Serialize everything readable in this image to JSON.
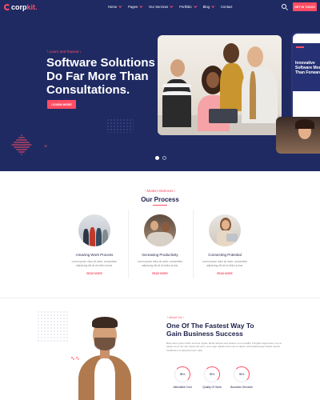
{
  "brand": {
    "logo_main": "corp",
    "logo_accent": "kit."
  },
  "nav": {
    "items": [
      {
        "label": "Home"
      },
      {
        "label": "Pages"
      },
      {
        "label": "Our Services"
      },
      {
        "label": "Portfolio"
      },
      {
        "label": "Blog"
      },
      {
        "label": "Contact"
      }
    ],
    "cta": "GET IN TOUCH"
  },
  "hero": {
    "eyebrow": "\\ Learn and Repeat \\",
    "title": "Software Solutions Do Far More Than Consultations.",
    "button": "LEARN MORE",
    "phone_text": "Innovative Software More Than Forward"
  },
  "process": {
    "eyebrow": "\\ Modern Business \\",
    "title": "Our Process",
    "steps": [
      {
        "title": "Amazing Work Process",
        "desc": "Lorem ipsum dolor sit amet, consectetur adipiscing elit sit do tellus luctus.",
        "link": "READ MORE"
      },
      {
        "title": "Increasing Productivity",
        "desc": "Lorem ipsum dolor sit amet, consectetur adipiscing elit sit do tellus luctus.",
        "link": "READ MORE"
      },
      {
        "title": "Connecting Potential",
        "desc": "Lorem ipsum dolor sit amet, consectetur adipiscing elit sit do tellus luctus.",
        "link": "READ MORE"
      }
    ]
  },
  "about": {
    "eyebrow": "\\ About Us \\",
    "title": "One Of The Fastest Way To Gain Business Success",
    "body": "Bran lorem ipsum dolor sit amet, ligula. Morbi ultricies sed ultrices ut a convallis, Fringilla magna lacu, nec at sapien semi nisi nisl. Quam elit vel in nunc eget. Eleifend dui sed ut sapien velit pellentesque facilisi mauris. Vestibulum et placerat tortor nulla.",
    "stats": [
      {
        "value": "98%",
        "percent": 98,
        "label": "Affordable Cost"
      },
      {
        "value": "99%",
        "percent": 99,
        "label": "Quality Of Work"
      },
      {
        "value": "95%",
        "percent": 95,
        "label": "Business Services"
      }
    ]
  },
  "colors": {
    "accent": "#ff4d63",
    "navy": "#1f2a63",
    "heading": "#1d1f4a"
  }
}
